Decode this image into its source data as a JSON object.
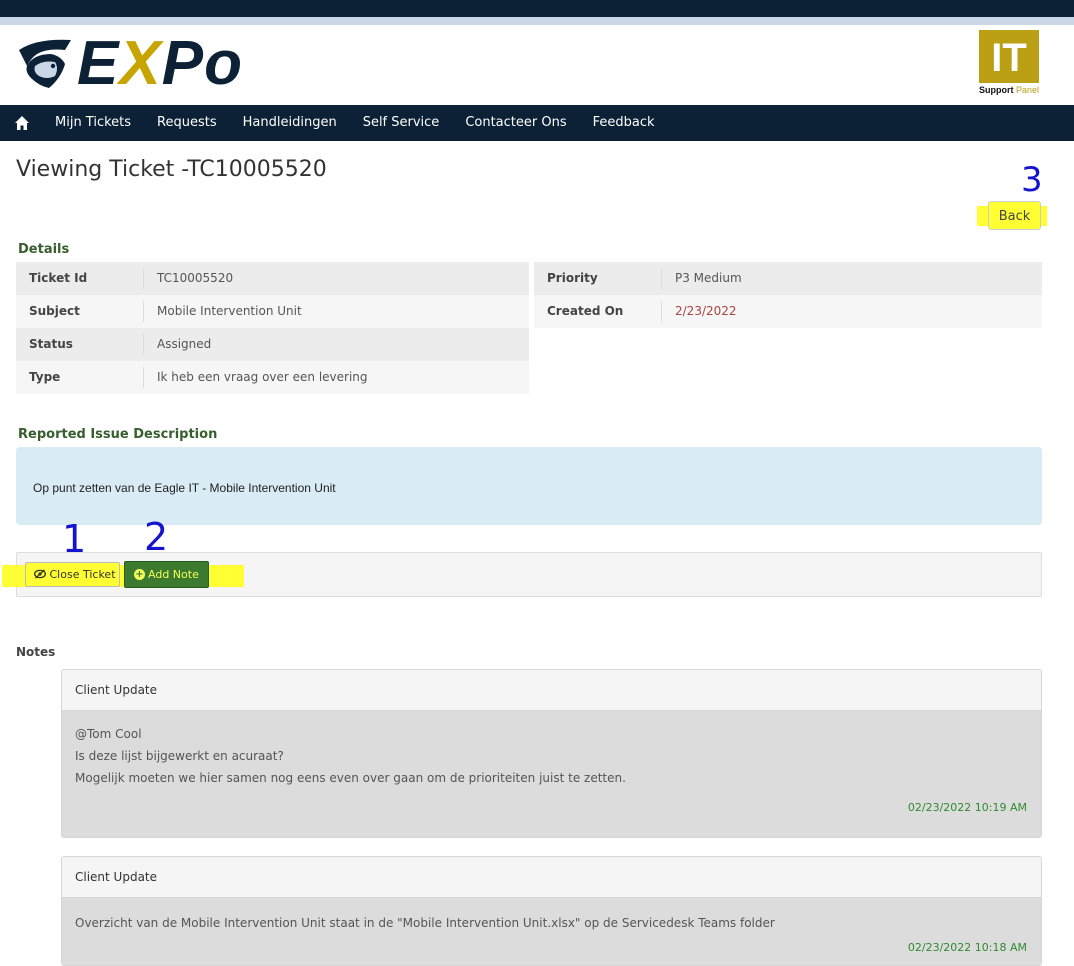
{
  "header": {
    "logo_text_e": "E",
    "logo_text_x": "X",
    "logo_text_po": "Po",
    "badge_it": "IT",
    "badge_support": "Support",
    "badge_panel": "Panel"
  },
  "nav": {
    "items": [
      "Mijn Tickets",
      "Requests",
      "Handleidingen",
      "Self Service",
      "Contacteer Ons",
      "Feedback"
    ]
  },
  "page": {
    "title": "Viewing Ticket -TC10005520",
    "back_label": "Back"
  },
  "annotations": [
    "1",
    "2",
    "3"
  ],
  "details": {
    "heading": "Details",
    "left": [
      {
        "label": "Ticket Id",
        "value": "TC10005520"
      },
      {
        "label": "Subject",
        "value": "Mobile Intervention Unit"
      },
      {
        "label": "Status",
        "value": "Assigned"
      },
      {
        "label": "Type",
        "value": "Ik heb een vraag over een levering"
      }
    ],
    "right": [
      {
        "label": "Priority",
        "value": "P3 Medium"
      },
      {
        "label": "Created On",
        "value": "2/23/2022"
      }
    ]
  },
  "description": {
    "heading": "Reported Issue Description",
    "text": "Op punt zetten van de Eagle IT - Mobile Intervention Unit"
  },
  "actions": {
    "close_label": "Close Ticket",
    "add_note_label": "Add Note"
  },
  "notes": {
    "heading": "Notes",
    "items": [
      {
        "title": "Client Update",
        "lines": [
          "@Tom Cool",
          "Is deze lijst bijgewerkt en acuraat?",
          "Mogelijk moeten we hier samen nog eens even over gaan om de prioriteiten juist te zetten."
        ],
        "timestamp": "02/23/2022 10:19 AM"
      },
      {
        "title": "Client Update",
        "lines": [
          "Overzicht van de Mobile Intervention Unit staat in de \"Mobile Intervention Unit.xlsx\" op de Servicedesk Teams folder"
        ],
        "timestamp": "02/23/2022 10:18 AM"
      }
    ]
  },
  "colors": {
    "navy": "#0c2135",
    "gold": "#c8a400",
    "section_green": "#375e2d",
    "highlight_yellow": "#ffff33",
    "annotation_blue": "#1414d0"
  }
}
